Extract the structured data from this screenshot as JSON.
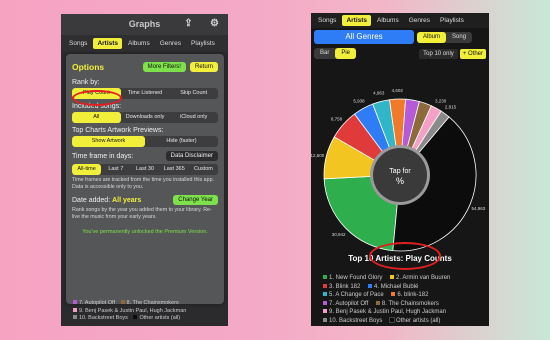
{
  "left": {
    "title": "Graphs",
    "tabs": [
      "Songs",
      "Artists",
      "Albums",
      "Genres",
      "Playlists"
    ],
    "active_tab": 1,
    "options": {
      "title": "Options",
      "more_filters": "More Filters!",
      "return": "Return",
      "rank_by_label": "Rank by:",
      "rank_by": [
        "Play Count",
        "Time Listened",
        "Skip Count"
      ],
      "included_label": "Included songs:",
      "included": [
        "All",
        "Downloads only",
        "iCloud only"
      ],
      "artwork_label": "Top Charts Artwork Previews:",
      "artwork": [
        "Show Artwork",
        "Hide (faster)"
      ],
      "timeframe_label": "Time frame in days:",
      "disclaimer": "Data Disclaimer",
      "timeframe": [
        "All-time",
        "Last 7",
        "Last 30",
        "Last 365",
        "Custom"
      ],
      "timeframe_note": "Time frames are tracked from the time you installed this app. Data is accessible only to you.",
      "date_added_label": "Date added:",
      "date_added_value": "All years",
      "change_year": "Change Year",
      "date_note": "Rank songs by the year you added them to your library. Re-live the music from your early years.",
      "premium": "You've permanently unlocked the Premium Version."
    },
    "artists_peek": [
      "7. Autopilot Off",
      "8. The Chainsmokers",
      "9. Benj Pasek & Justin Paul, Hugh Jackman",
      "10. Backstreet Boys",
      "Other artists (all)"
    ]
  },
  "right": {
    "tabs": [
      "Songs",
      "Artists",
      "Albums",
      "Genres",
      "Playlists"
    ],
    "active_tab": 1,
    "all_genres": "All Genres",
    "album_song": [
      "Album",
      "Song"
    ],
    "bar_pie": [
      "Bar",
      "Pie"
    ],
    "top10": "Top 10 only",
    "other": "+ Other",
    "center_label": "Tap for %",
    "chart_title": "Top 10 Artists: Play Counts",
    "legend": [
      "1. New Found Glory",
      "2. Armin van Buuren",
      "3. Blink 182",
      "4. Michael Bublé",
      "5. A Change of Pace",
      "6. blink-182",
      "7. Autopilot Off",
      "8. The Chainsmokers",
      "9. Benj Pasek & Justin Paul, Hugh Jackman",
      "10. Backstreet Boys",
      "Other artists (all)"
    ]
  },
  "chart_data": {
    "type": "pie",
    "title": "Top 10 Artists: Play Counts",
    "series": [
      {
        "name": "1. New Found Glory",
        "value": 30942,
        "color": "#2fae4d"
      },
      {
        "name": "2. Armin van Buuren",
        "value": 12500,
        "color": "#f3c520"
      },
      {
        "name": "3. Blink 182",
        "value": 8758,
        "color": "#e03a3a"
      },
      {
        "name": "4. Michael Bublé",
        "value": 5938,
        "color": "#2f7cf7"
      },
      {
        "name": "5. A Change of Pace",
        "value": 4963,
        "color": "#30b6c8"
      },
      {
        "name": "6. blink-182",
        "value": 4602,
        "color": "#f07a2a"
      },
      {
        "name": "7. Autopilot Off",
        "value": 4000,
        "color": "#b75ad8"
      },
      {
        "name": "8. The Chainsmokers",
        "value": 3600,
        "color": "#8c6a3a"
      },
      {
        "name": "9. Benj Pasek & Justin Paul, Hugh Jackman",
        "value": 3200,
        "color": "#f3a0c6"
      },
      {
        "name": "10. Backstreet Boys",
        "value": 2815,
        "color": "#8a8a8a"
      },
      {
        "name": "Other artists (all)",
        "value": 54963,
        "color": "#0c0c0c"
      }
    ],
    "labels": [
      "30,942",
      "12,500",
      "8,758",
      "5,938",
      "4,963",
      "4,602",
      "",
      "",
      "3,230",
      "2,815",
      "54,963"
    ]
  }
}
